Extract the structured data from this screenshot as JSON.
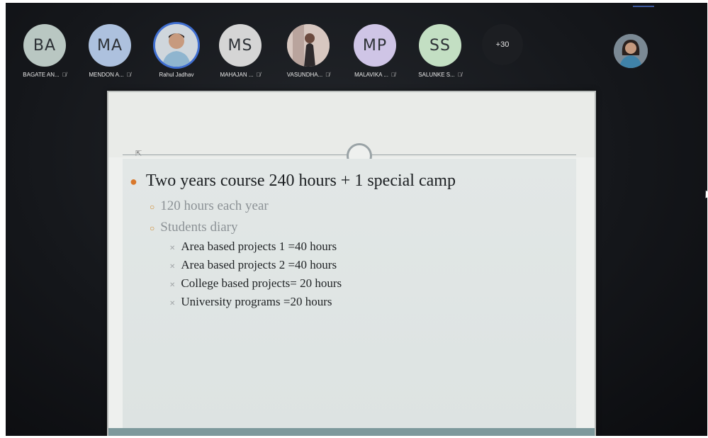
{
  "participants": [
    {
      "initials": "BA",
      "name": "BAGATE AN...",
      "color": "#b9c7c2",
      "muted": true
    },
    {
      "initials": "MA",
      "name": "MENDON A...",
      "color": "#adc1de",
      "muted": true
    },
    {
      "initials": "",
      "name": "Rahul Jadhav",
      "color": "#c6ced6",
      "muted": false,
      "photo": true,
      "active": true
    },
    {
      "initials": "MS",
      "name": "MAHAJAN ...",
      "color": "#d5d5d5",
      "muted": true
    },
    {
      "initials": "",
      "name": "VASUNDHA...",
      "color": "#c9b7b4",
      "muted": true,
      "photo": true
    },
    {
      "initials": "MP",
      "name": "MALAVIKA ...",
      "color": "#cfc5e6",
      "muted": true
    },
    {
      "initials": "SS",
      "name": "SALUNKE S...",
      "color": "#c3dfc3",
      "muted": true
    }
  ],
  "more_count": "+30",
  "slide": {
    "level1": [
      {
        "text": "Two years course 240 hours + 1 special camp"
      }
    ],
    "level2": [
      {
        "text": "120 hours each year"
      },
      {
        "text": "Students diary"
      }
    ],
    "level3": [
      {
        "text": "Area based projects 1 =40 hours"
      },
      {
        "text": "Area based projects 2 =40 hours"
      },
      {
        "text": "College based projects= 20 hours"
      },
      {
        "text": "University programs =20 hours"
      }
    ]
  },
  "icons": {
    "muted_mic": "muted-mic-icon",
    "pointer": "mouse-pointer-icon"
  }
}
